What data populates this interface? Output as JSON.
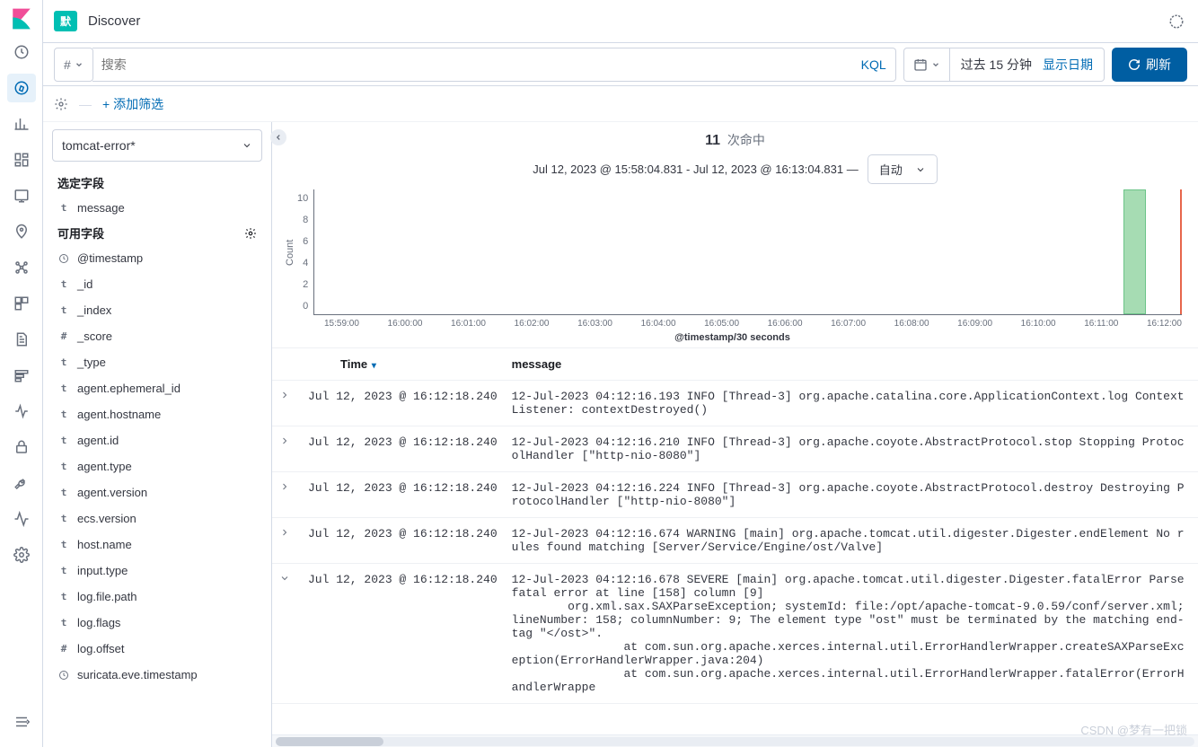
{
  "topbar": {
    "badge": "默",
    "title": "Discover"
  },
  "querybar": {
    "hash": "#",
    "search_placeholder": "搜索",
    "kql": "KQL",
    "date_label": "过去 15 分钟",
    "show_date": "显示日期",
    "refresh": "刷新"
  },
  "filterbar": {
    "add_filter": "+ 添加筛选"
  },
  "sidebar": {
    "index_pattern": "tomcat-error*",
    "selected_title": "选定字段",
    "selected_fields": [
      {
        "type": "t",
        "name": "message"
      }
    ],
    "available_title": "可用字段",
    "available_fields": [
      {
        "type": "clock",
        "name": "@timestamp"
      },
      {
        "type": "t",
        "name": "_id"
      },
      {
        "type": "t",
        "name": "_index"
      },
      {
        "type": "#",
        "name": "_score"
      },
      {
        "type": "t",
        "name": "_type"
      },
      {
        "type": "t",
        "name": "agent.ephemeral_id"
      },
      {
        "type": "t",
        "name": "agent.hostname"
      },
      {
        "type": "t",
        "name": "agent.id"
      },
      {
        "type": "t",
        "name": "agent.type"
      },
      {
        "type": "t",
        "name": "agent.version"
      },
      {
        "type": "t",
        "name": "ecs.version"
      },
      {
        "type": "t",
        "name": "host.name"
      },
      {
        "type": "t",
        "name": "input.type"
      },
      {
        "type": "t",
        "name": "log.file.path"
      },
      {
        "type": "t",
        "name": "log.flags"
      },
      {
        "type": "#",
        "name": "log.offset"
      },
      {
        "type": "clock",
        "name": "suricata.eve.timestamp"
      }
    ]
  },
  "hits": {
    "count": "11",
    "label": "次命中"
  },
  "range": {
    "text": "Jul 12, 2023 @ 15:58:04.831 - Jul 12, 2023 @ 16:13:04.831 —",
    "interval": "自动"
  },
  "chart_data": {
    "type": "bar",
    "ylabel": "Count",
    "xlabel": "@timestamp/30 seconds",
    "y_ticks": [
      "10",
      "8",
      "6",
      "4",
      "2",
      "0"
    ],
    "x_ticks": [
      "15:59:00",
      "16:00:00",
      "16:01:00",
      "16:02:00",
      "16:03:00",
      "16:04:00",
      "16:05:00",
      "16:06:00",
      "16:07:00",
      "16:08:00",
      "16:09:00",
      "16:10:00",
      "16:11:00",
      "16:12:00"
    ],
    "ylim": [
      0,
      11
    ],
    "bars": [
      {
        "x_pct": 93.3,
        "width_pct": 2.6,
        "value": 11
      }
    ]
  },
  "table": {
    "headers": {
      "time": "Time",
      "message": "message"
    },
    "rows": [
      {
        "expanded": false,
        "time": "Jul 12, 2023 @ 16:12:18.240",
        "message": "12-Jul-2023 04:12:16.193 INFO [Thread-3] org.apache.catalina.core.ApplicationContext.log ContextListener: contextDestroyed()"
      },
      {
        "expanded": false,
        "time": "Jul 12, 2023 @ 16:12:18.240",
        "message": "12-Jul-2023 04:12:16.210 INFO [Thread-3] org.apache.coyote.AbstractProtocol.stop Stopping ProtocolHandler [\"http-nio-8080\"]"
      },
      {
        "expanded": false,
        "time": "Jul 12, 2023 @ 16:12:18.240",
        "message": "12-Jul-2023 04:12:16.224 INFO [Thread-3] org.apache.coyote.AbstractProtocol.destroy Destroying ProtocolHandler [\"http-nio-8080\"]"
      },
      {
        "expanded": false,
        "time": "Jul 12, 2023 @ 16:12:18.240",
        "message": "12-Jul-2023 04:12:16.674 WARNING [main] org.apache.tomcat.util.digester.Digester.endElement No rules found matching [Server/Service/Engine/ost/Valve]"
      },
      {
        "expanded": true,
        "time": "Jul 12, 2023 @ 16:12:18.240",
        "message": "12-Jul-2023 04:12:16.678 SEVERE [main] org.apache.tomcat.util.digester.Digester.fatalError Parse fatal error at line [158] column [9]\n        org.xml.sax.SAXParseException; systemId: file:/opt/apache-tomcat-9.0.59/conf/server.xml; lineNumber: 158; columnNumber: 9; The element type \"ost\" must be terminated by the matching end-tag \"</ost>\".\n                at com.sun.org.apache.xerces.internal.util.ErrorHandlerWrapper.createSAXParseException(ErrorHandlerWrapper.java:204)\n                at com.sun.org.apache.xerces.internal.util.ErrorHandlerWrapper.fatalError(ErrorHandlerWrappe"
      }
    ]
  },
  "watermark": "CSDN @梦有一把锁"
}
